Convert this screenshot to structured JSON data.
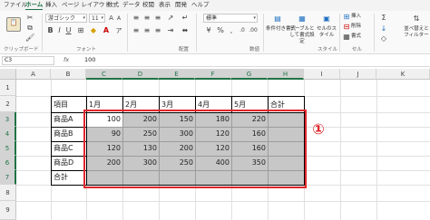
{
  "menu": [
    "ファイル",
    "ホーム",
    "挿入",
    "ページ レイアウト",
    "数式",
    "データ",
    "校閲",
    "表示",
    "開発",
    "ヘルプ"
  ],
  "ribbon": {
    "font_name": "游ゴシック",
    "font_size": "11",
    "number_format": "標準",
    "groups": [
      "クリップボード",
      "フォント",
      "配置",
      "数値",
      "スタイル",
      "セル"
    ],
    "style_buttons": [
      "条件付き書式",
      "テーブルとして書式設定",
      "セルのスタイル"
    ],
    "cell_buttons": [
      "挿入",
      "削除",
      "書式"
    ],
    "edit_button": "並べ替えとフィルター"
  },
  "formula_bar": {
    "name_box": "C3",
    "fx": "fx",
    "value": "100"
  },
  "columns": [
    "A",
    "B",
    "C",
    "D",
    "E",
    "F",
    "G",
    "H",
    "I",
    "J",
    "K"
  ],
  "rows": [
    "1",
    "2",
    "3",
    "4",
    "5",
    "6",
    "7",
    "8",
    "9"
  ],
  "table": {
    "header": [
      "項目",
      "1月",
      "2月",
      "3月",
      "4月",
      "5月",
      "合計"
    ],
    "rows": [
      {
        "label": "商品A",
        "values": [
          "100",
          "200",
          "150",
          "180",
          "220",
          ""
        ]
      },
      {
        "label": "商品B",
        "values": [
          "90",
          "250",
          "300",
          "120",
          "160",
          ""
        ]
      },
      {
        "label": "商品C",
        "values": [
          "120",
          "130",
          "200",
          "120",
          "160",
          ""
        ]
      },
      {
        "label": "商品D",
        "values": [
          "200",
          "300",
          "250",
          "400",
          "350",
          ""
        ]
      },
      {
        "label": "合計",
        "values": [
          "",
          "",
          "",
          "",
          "",
          ""
        ]
      }
    ]
  },
  "annotation": "①",
  "colors": {
    "accent": "#217346",
    "selection_fill": "#c7c7c7",
    "highlight": "#e0262b"
  }
}
